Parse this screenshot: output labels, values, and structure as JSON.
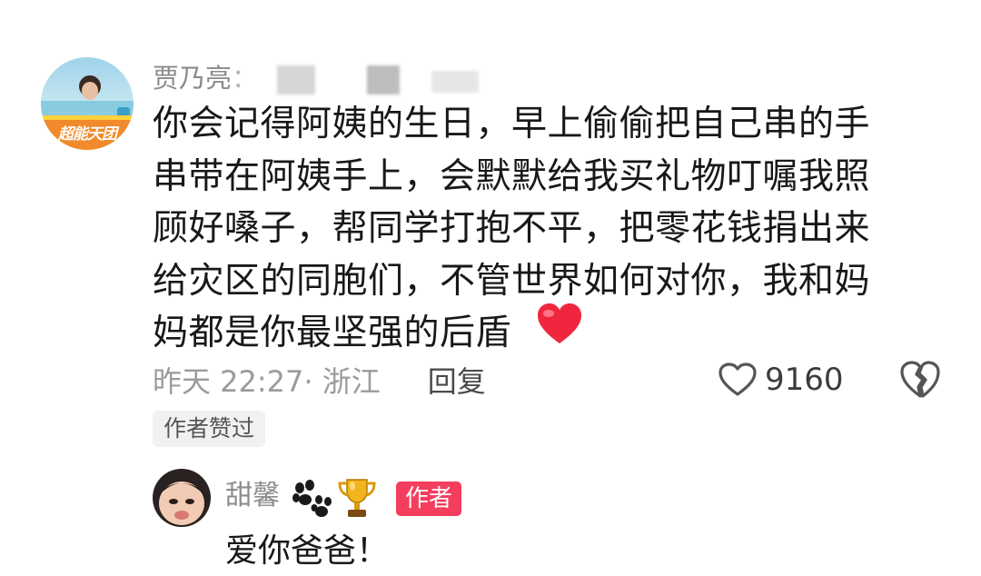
{
  "comment": {
    "username": "贾乃亮",
    "username_suffix": "：",
    "avatar_badge_text": "超能天团",
    "text": "你会记得阿姨的生日，早上偷偷把自己串的手\n串带在阿姨手上，会默默给我买礼物叮嘱我照\n顾好嗓子，帮同学打抱不平，把零花钱捐出来\n给灾区的同胞们，不管世界如何对你，我和妈\n妈都是你最坚强的后盾",
    "heart_emoji": "heart-emoji",
    "time_location": "昨天 22:27· 浙江",
    "reply_label": "回复",
    "like_count": "9160",
    "author_liked_label": "作者赞过"
  },
  "reply": {
    "username": "甜馨",
    "badge_icons": [
      "paw-icon",
      "trophy-icon"
    ],
    "author_badge": "作者",
    "text": "爱你爸爸！"
  },
  "colors": {
    "meta_gray": "#9b9b9b",
    "author_badge_red": "#f53d5e",
    "heart_red": "#f0263f"
  }
}
